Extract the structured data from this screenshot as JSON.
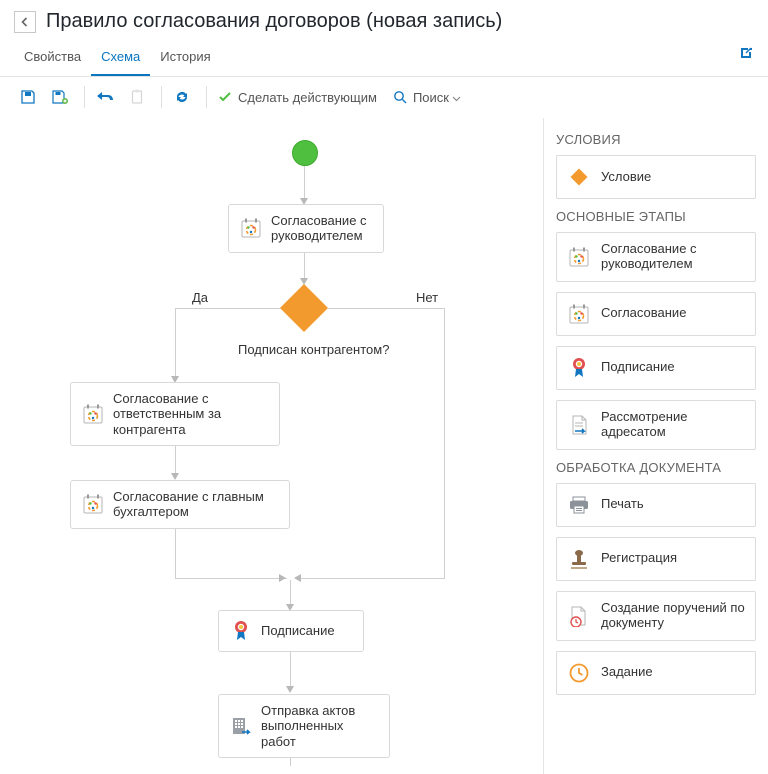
{
  "header": {
    "title": "Правило согласования договоров (новая запись)"
  },
  "tabs": {
    "items": [
      "Свойства",
      "Схема",
      "История"
    ],
    "active_index": 1
  },
  "toolbar": {
    "make_effective": "Сделать действующим",
    "search": "Поиск"
  },
  "flow": {
    "nodes": {
      "manager": "Согласование с руководителем",
      "responsible": "Согласование с ответственным за контрагента",
      "accountant": "Согласование с главным бухгалтером",
      "signing": "Подписание",
      "dispatch": "Отправка актов выполненных работ"
    },
    "condition_label": "Подписан контрагентом?",
    "branch_yes": "Да",
    "branch_no": "Нет"
  },
  "panel": {
    "sections": {
      "conditions": {
        "title": "УСЛОВИЯ",
        "items": [
          {
            "k": "condition",
            "label": "Условие"
          }
        ]
      },
      "main_stages": {
        "title": "ОСНОВНЫЕ ЭТАПЫ",
        "items": [
          {
            "k": "manager",
            "label": "Согласование с руководителем"
          },
          {
            "k": "approval",
            "label": "Согласование"
          },
          {
            "k": "signing",
            "label": "Подписание"
          },
          {
            "k": "review",
            "label": "Рассмотрение адресатом"
          }
        ]
      },
      "processing": {
        "title": "ОБРАБОТКА ДОКУМЕНТА",
        "items": [
          {
            "k": "print",
            "label": "Печать"
          },
          {
            "k": "register",
            "label": "Регистрация"
          },
          {
            "k": "orders",
            "label": "Создание поручений по документу"
          },
          {
            "k": "task",
            "label": "Задание"
          }
        ]
      }
    }
  }
}
